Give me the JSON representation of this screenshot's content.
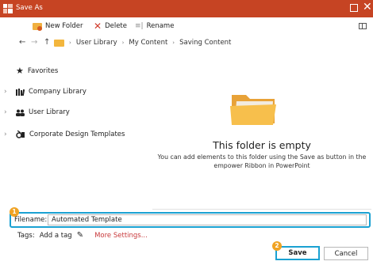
{
  "window": {
    "title": "Save As",
    "accent": "#c64423"
  },
  "toolbar": {
    "new_folder": "New Folder",
    "delete": "Delete",
    "rename": "Rename"
  },
  "nav": {
    "back": "←",
    "forward": "→",
    "up": "↑",
    "breadcrumb": [
      "User Library",
      "My Content",
      "Saving Content"
    ]
  },
  "sidebar": {
    "favorites": "Favorites",
    "items": [
      {
        "label": "Company Library",
        "icon": "books-icon"
      },
      {
        "label": "User Library",
        "icon": "users-icon"
      },
      {
        "label": "Corporate Design Templates",
        "icon": "design-templates-icon"
      }
    ]
  },
  "main": {
    "empty_title": "This folder is empty",
    "empty_desc": "You can add elements to this folder using the Save as button in the empower Ribbon in PowerPoint"
  },
  "filename": {
    "label": "Filename:",
    "value": "Automated Template"
  },
  "tags": {
    "label": "Tags:",
    "add": "Add a tag",
    "more": "More Settings..."
  },
  "buttons": {
    "save": "Save",
    "cancel": "Cancel"
  },
  "badges": [
    "1",
    "2"
  ],
  "colors": {
    "highlight": "#1aa1d2",
    "badge": "#f0a324",
    "link": "#c8393b"
  }
}
